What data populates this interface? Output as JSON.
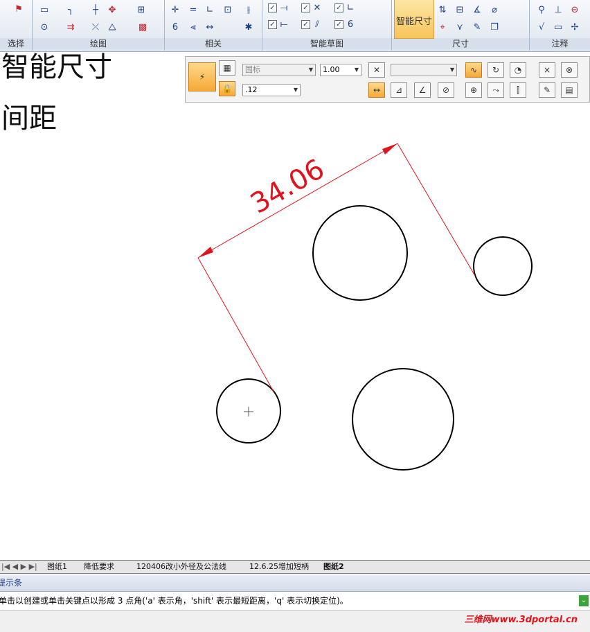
{
  "ribbon": {
    "groups": {
      "select": "选择",
      "draw": "绘图",
      "relate": "相关",
      "smart_sketch": "智能草图",
      "dimension": "尺寸",
      "annotation": "注释"
    },
    "smart_dimension_label": "智能尺寸"
  },
  "canvas": {
    "heading1": "智能尺寸",
    "heading2": "间距",
    "dimension_value": "34.06",
    "dimension_color": "#e0141e"
  },
  "command_bar": {
    "style": "国标",
    "scale": "1.00",
    "precision": ".12",
    "close_x": "×",
    "close_circle": "⊗"
  },
  "sheet_tabs": [
    "图纸1",
    "降低要求",
    "120406改小外径及公法线",
    "12.6.25增加短柄",
    "图纸2"
  ],
  "active_tab": "图纸2",
  "prompt": {
    "title": "提示条",
    "text": "单击以创建或单击关键点以形成 3 点角('a' 表示角，'shift' 表示最短距离，'q' 表示切换定位)。"
  },
  "watermark": "三维网www.3dportal.cn"
}
